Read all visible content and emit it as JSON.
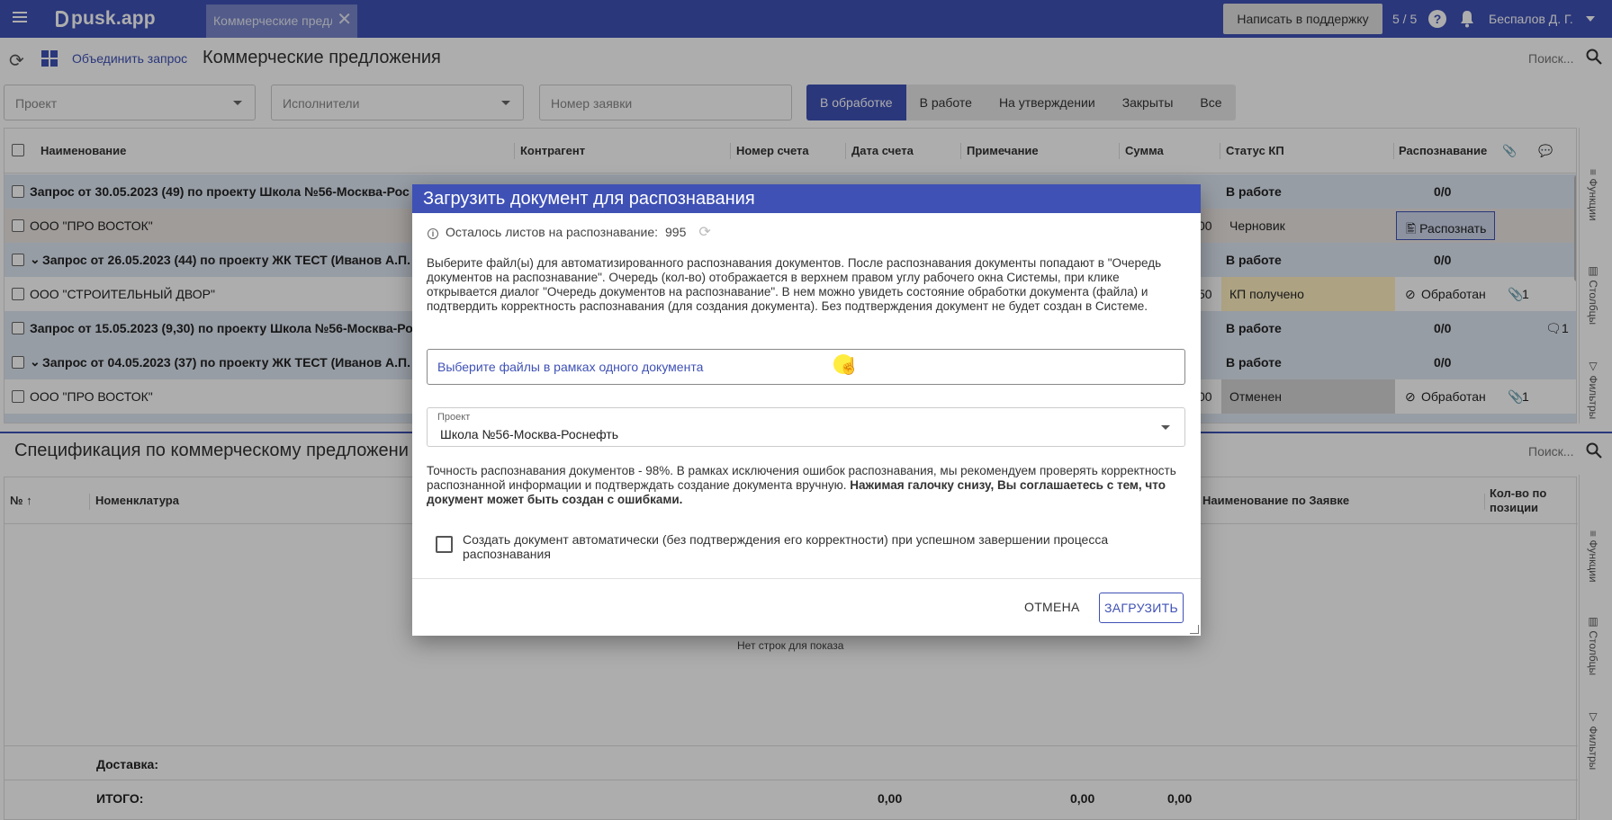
{
  "app": {
    "logo": "pusk.app"
  },
  "topbar": {
    "tab_label": "Коммерческие предл",
    "support_label": "Написать в поддержку",
    "count": "5 / 5",
    "help_glyph": "?",
    "user": "Беспалов Д. Г."
  },
  "toolbar": {
    "merge_label": "Объединить запрос",
    "title": "Коммерческие предложения",
    "search_label": "Поиск..."
  },
  "filters": {
    "project_placeholder": "Проект",
    "executors_placeholder": "Исполнители",
    "request_placeholder": "Номер заявки",
    "segments": [
      "В обработке",
      "В работе",
      "На утверждении",
      "Закрыты",
      "Все"
    ]
  },
  "grid": {
    "headers": {
      "name": "Наименование",
      "contractor": "Контрагент",
      "invoice_no": "Номер счета",
      "invoice_date": "Дата счета",
      "note": "Примечание",
      "sum": "Сумма",
      "status": "Статус КП",
      "recognition": "Распознавание"
    },
    "rows": [
      {
        "name": "Запрос от 30.05.2023 (49) по проекту Школа №56-Москва-Рос",
        "status": "В работе",
        "recog": "0/0"
      },
      {
        "name": "ООО \"ПРО ВОСТОК\"",
        "sum": "00",
        "status": "Черновик",
        "recog": "Распознать"
      },
      {
        "name": "Запрос от 26.05.2023 (44) по проекту ЖК ТЕСТ (Иванов А.П.",
        "status": "В работе",
        "recog": "0/0"
      },
      {
        "name": "ООО \"СТРОИТЕЛЬНЫЙ ДВОР\"",
        "sum": "50",
        "status": "КП получено",
        "recog": "Обработан",
        "attach": "1"
      },
      {
        "name": "Запрос от 15.05.2023 (9,30) по проекту Школа №56-Москва-Ро",
        "status": "В работе",
        "recog": "0/0",
        "comments": "1"
      },
      {
        "name": "Запрос от 04.05.2023 (37) по проекту ЖК ТЕСТ (Иванов А.П.",
        "status": "В работе",
        "recog": "0/0"
      },
      {
        "name": "ООО \"ПРО ВОСТОК\"",
        "sum": "00",
        "status": "Отменен",
        "recog": "Обработан",
        "attach": "1"
      }
    ]
  },
  "side_panel": {
    "functions": "Функции",
    "columns": "Столбцы",
    "filters": "Фильтры"
  },
  "spec": {
    "title": "Спецификация по коммерческому предложени",
    "search_label": "Поиск...",
    "headers": {
      "num": "№ ↑",
      "nomenclature": "Номенклатура",
      "request_name": "Наименование по Заявке",
      "qty": "Кол-во по позиции"
    },
    "empty": "Нет строк для показа",
    "delivery_label": "Доставка:",
    "total_label": "ИТОГО:",
    "totals": [
      "0,00",
      "0,00",
      "0,00"
    ]
  },
  "dialog": {
    "title": "Загрузить документ для распознавания",
    "remaining_label": "Осталось листов на распознавание:",
    "remaining_value": "995",
    "description": "Выберите файл(ы) для автоматизированного распознавания документов. После распознавания документы попадают в \"Очередь документов на распознавание\". Очередь (кол-во) отображается в верхнем правом углу рабочего окна Системы, при клике открывается диалог \"Очередь документов на распознавание\". В нем можно увидеть состояние обработки документа (файла) и подтвердить корректность распознавания (для создания документа). Без подтверждения документ не будет создан в Системе.",
    "file_placeholder": "Выберите файлы в рамках одного документа",
    "project_label": "Проект",
    "project_value": "Школа №56-Москва-Роснефть",
    "accuracy_text": "Точность распознавания документов - 98%. В рамках исключения ошибок распознавания, мы рекомендуем проверять корректность распознанной информации и подтверждать создание документа вручную.",
    "accuracy_bold": "Нажимая галочку снизу, Вы соглашаетесь с тем, что документ может быть создан с ошибками.",
    "auto_create": "Создать документ автоматически (без подтверждения его корректности) при успешном завершении процесса распознавания",
    "cancel_label": "ОТМЕНА",
    "upload_label": "ЗАГРУЗИТЬ"
  }
}
